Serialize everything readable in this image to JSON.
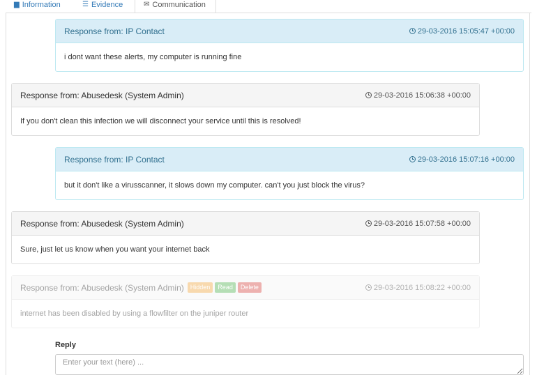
{
  "tabs": [
    {
      "label": "Information",
      "icon": "file-icon",
      "active": false
    },
    {
      "label": "Evidence",
      "icon": "list-icon",
      "active": false
    },
    {
      "label": "Communication",
      "icon": "envelope-icon",
      "active": true
    }
  ],
  "messages": [
    {
      "from": "Response from: IP Contact",
      "timestamp": "29-03-2016 15:05:47 +00:00",
      "body": "i dont want these alerts, my computer is running fine",
      "role": "ip-contact"
    },
    {
      "from": "Response from: Abusedesk (System Admin)",
      "timestamp": "29-03-2016 15:06:38 +00:00",
      "body": "If you don't clean this infection we will disconnect your service until this is resolved!",
      "role": "admin"
    },
    {
      "from": "Response from: IP Contact",
      "timestamp": "29-03-2016 15:07:16 +00:00",
      "body": "but it don't like a virusscanner, it slows down my computer. can't you just block the virus?",
      "role": "ip-contact"
    },
    {
      "from": "Response from: Abusedesk (System Admin)",
      "timestamp": "29-03-2016 15:07:58 +00:00",
      "body": "Sure, just let us know when you want your internet back",
      "role": "admin"
    },
    {
      "from": "Response from: Abusedesk (System Admin)",
      "timestamp": "29-03-2016 15:08:22 +00:00",
      "body": "internet has been disabled by using a flowfilter on the juniper router",
      "role": "admin",
      "labels": [
        "Hidden",
        "Read",
        "Delete"
      ]
    }
  ],
  "reply": {
    "label": "Reply",
    "placeholder": "Enter your text (here) ..."
  },
  "colors": {
    "link": "#337ab7",
    "ip_heading_bg": "#d9edf7",
    "ip_heading_text": "#31708f",
    "admin_heading_bg": "#f5f5f5",
    "hidden": "#f0ad4e",
    "read": "#5cb85c",
    "delete": "#d9534f"
  }
}
